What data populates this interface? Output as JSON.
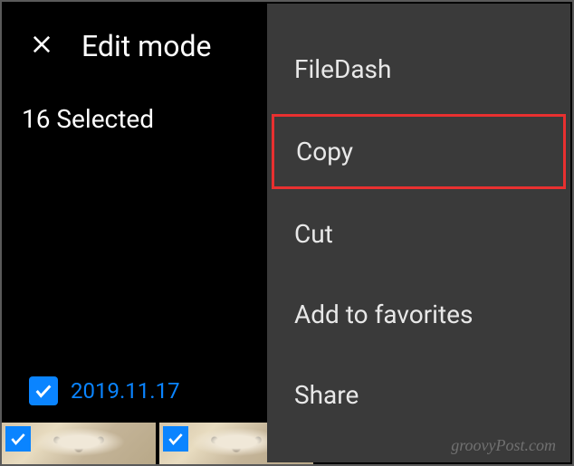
{
  "header": {
    "title": "Edit mode"
  },
  "status": {
    "selected_count": "16 Selected"
  },
  "date_group": {
    "date": "2019.11.17",
    "checked": true
  },
  "menu": {
    "items": [
      {
        "label": "FileDash",
        "highlighted": false
      },
      {
        "label": "Copy",
        "highlighted": true
      },
      {
        "label": "Cut",
        "highlighted": false
      },
      {
        "label": "Add to favorites",
        "highlighted": false
      },
      {
        "label": "Share",
        "highlighted": false
      }
    ]
  },
  "watermark": "groovyPost.com"
}
